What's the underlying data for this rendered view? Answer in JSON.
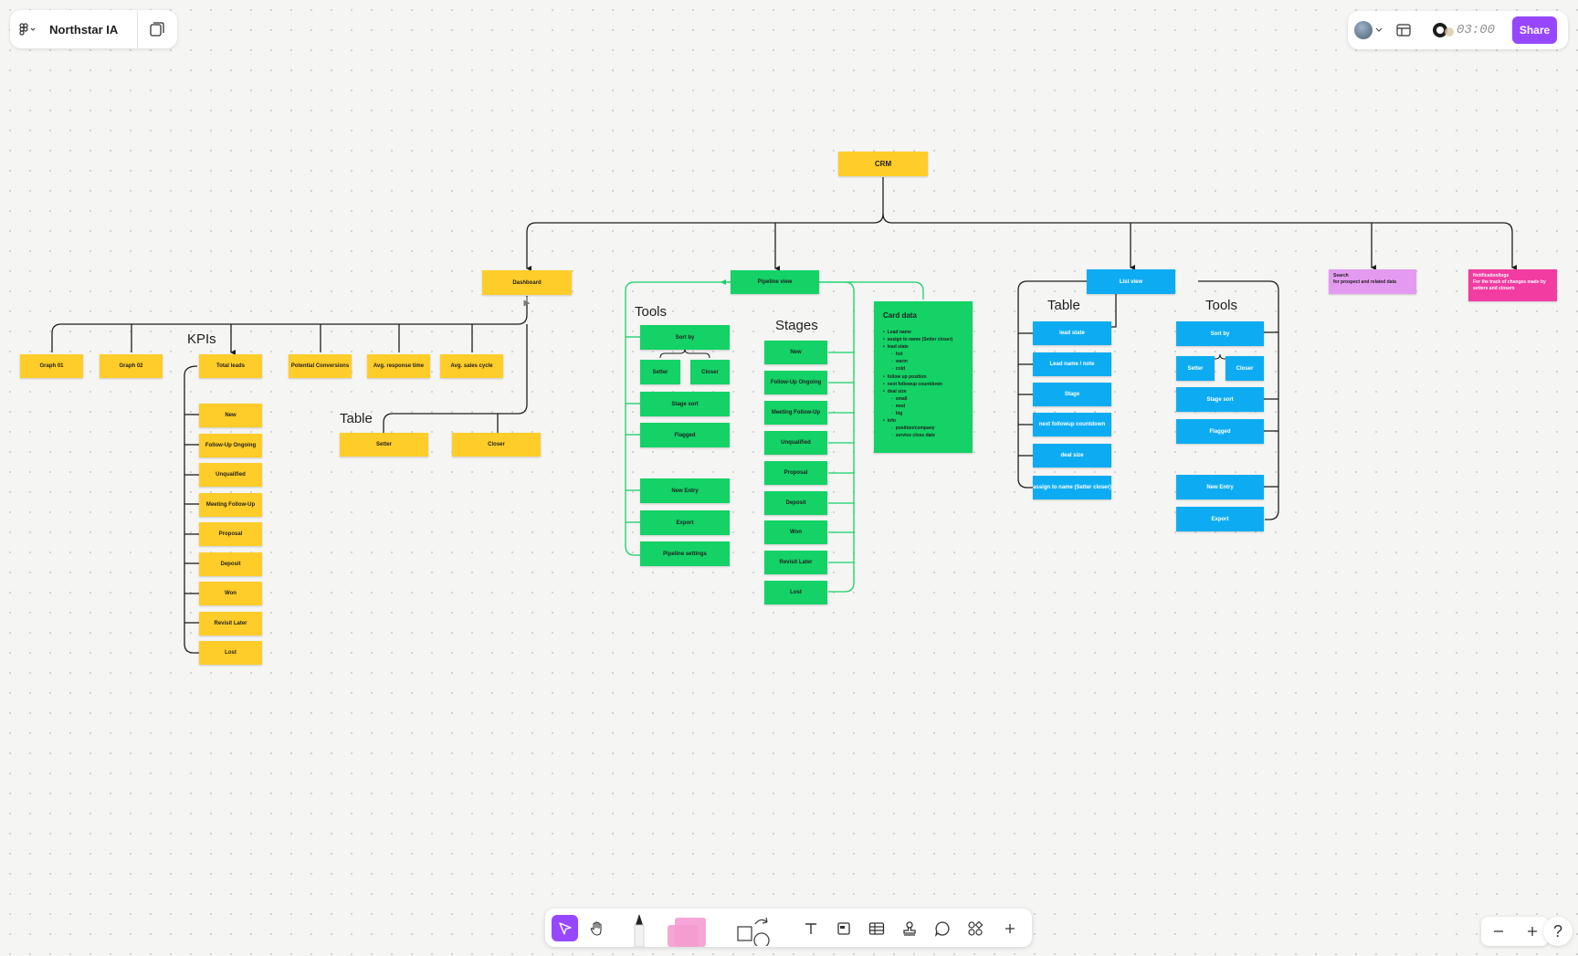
{
  "file": {
    "name": "Northstar IA"
  },
  "header": {
    "timer": "03:00",
    "share_label": "Share"
  },
  "colors": {
    "yellow": "#ffcd29",
    "green": "#14d266",
    "blue": "#0dacf2",
    "purple": "#e49af0",
    "pink": "#f23ca2",
    "accent": "#9747ff"
  },
  "root": {
    "label": "CRM"
  },
  "dashboard": {
    "label": "Dashboard",
    "kpis_heading": "KPIs",
    "table_heading": "Table",
    "graphs": [
      "Graph 01",
      "Graph 02"
    ],
    "kpis": [
      "Total leads",
      "Potential Conversions",
      "Avg. response time",
      "Avg. sales cycle"
    ],
    "lead_states": [
      "New",
      "Follow-Up Ongoing",
      "Unqualified",
      "Meeting Follow-Up",
      "Proposal",
      "Deposit",
      "Won",
      "Revisit Later",
      "Lost"
    ],
    "table": [
      "Setter",
      "Closer"
    ]
  },
  "pipeline": {
    "label": "Pipeline view",
    "tools_heading": "Tools",
    "stages_heading": "Stages",
    "tools": {
      "sort_by": "Sort by",
      "setter": "Setter",
      "closer": "Closer",
      "stage_sort": "Stage sort",
      "flagged": "Flagged",
      "new_entry": "New Entry",
      "export": "Export",
      "settings": "Pipeline settings"
    },
    "stages": [
      "New",
      "Follow-Up Ongoing",
      "Meeting Follow-Up",
      "Unqualified",
      "Proposal",
      "Deposit",
      "Won",
      "Revisit Later",
      "Lost"
    ],
    "card": {
      "title": "Card data",
      "items": [
        {
          "text": "Lead name",
          "level": 1
        },
        {
          "text": "assign to name (Setter closer)",
          "level": 1
        },
        {
          "text": "lead state",
          "level": 1
        },
        {
          "text": "hot",
          "level": 2
        },
        {
          "text": "warm",
          "level": 2
        },
        {
          "text": "cold",
          "level": 2
        },
        {
          "text": "follow up position",
          "level": 1
        },
        {
          "text": "next followup countdown",
          "level": 1
        },
        {
          "text": "deal size",
          "level": 1
        },
        {
          "text": "small",
          "level": 2
        },
        {
          "text": "med",
          "level": 2
        },
        {
          "text": "big",
          "level": 2
        },
        {
          "text": "info",
          "level": 1
        },
        {
          "text": "position/company",
          "level": 2
        },
        {
          "text": "service close date",
          "level": 2
        }
      ]
    }
  },
  "listview": {
    "label": "List view",
    "table_heading": "Table",
    "tools_heading": "Tools",
    "table": [
      "lead state",
      "Lead name / note",
      "Stage",
      "next followup countdown",
      "deal size",
      "assign to name (Setter closer)"
    ],
    "tools": {
      "sort_by": "Sort by",
      "setter": "Setter",
      "closer": "Closer",
      "stage_sort": "Stage sort",
      "flagged": "Flagged",
      "new_entry": "New Entry",
      "export": "Export"
    }
  },
  "search": {
    "title": "Search",
    "body": "for prospect and related data"
  },
  "notification": {
    "title": "Notification/logs",
    "body": "For the track of changes made by setters and closers"
  }
}
